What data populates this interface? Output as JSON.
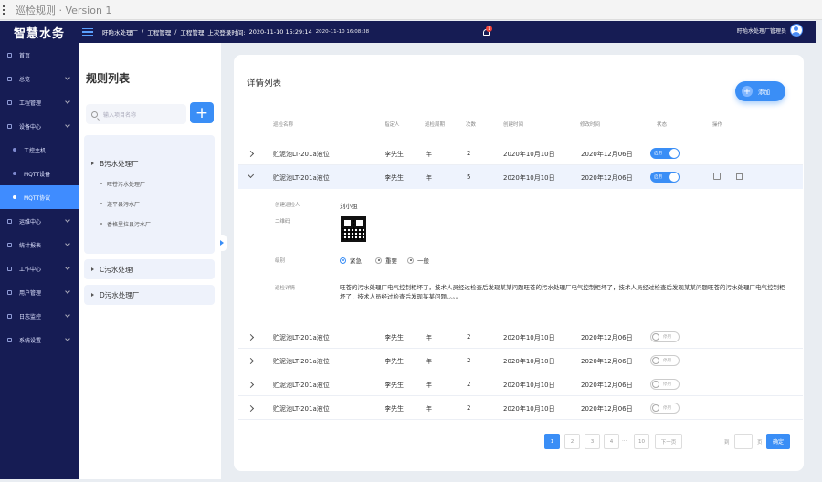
{
  "window": {
    "title": "巡检规则 · Version 1"
  },
  "topbar": {
    "brand": "智慧水务",
    "breadcrumb": [
      "盱眙水处理厂",
      "工程管理",
      "工程管理"
    ],
    "last_login_label": "上次登录时间:",
    "last_login_time": "2020-11-10 15:29:14",
    "current_time": "2020-11-10 16:08:38",
    "notification_count": "1",
    "user_name": "盱眙水处理厂管理员"
  },
  "sidebar": {
    "items": [
      {
        "label": "首页"
      },
      {
        "label": "总览"
      },
      {
        "label": "工程管理"
      },
      {
        "label": "设备中心"
      },
      {
        "label": "工控主机"
      },
      {
        "label": "MQTT设备"
      },
      {
        "label": "MQTT协议"
      },
      {
        "label": "运维中心"
      },
      {
        "label": "统计报表"
      },
      {
        "label": "工作中心"
      },
      {
        "label": "用户管理"
      },
      {
        "label": "日志监控"
      },
      {
        "label": "系统设置"
      }
    ]
  },
  "rules": {
    "title": "规则列表",
    "search_placeholder": "输入项目名称",
    "add_symbol": "+",
    "groups": [
      {
        "name": "B污水处理厂",
        "children": [
          "旺苍污水处理厂",
          "遂平县污水厂",
          "香格里拉县污水厂"
        ]
      },
      {
        "name": "C污水处理厂"
      },
      {
        "name": "D污水处理厂"
      }
    ]
  },
  "details": {
    "title": "详情列表",
    "add_label": "添加",
    "add_symbol": "+",
    "columns": [
      "巡检名称",
      "指定人",
      "巡检周期",
      "次数",
      "创建时间",
      "修改时间",
      "状态",
      "操作"
    ],
    "rows": [
      {
        "name": "贮泥池LT-201a液位",
        "person": "李先生",
        "period": "年",
        "count": "2",
        "created": "2020年10月10日",
        "modified": "2020年12月06日",
        "status": "启用"
      },
      {
        "name": "贮泥池LT-201a液位",
        "person": "李先生",
        "period": "年",
        "count": "5",
        "created": "2020年10月10日",
        "modified": "2020年12月06日",
        "status": "启用"
      },
      {
        "name": "贮泥池LT-201a液位",
        "person": "李先生",
        "period": "年",
        "count": "2",
        "created": "2020年10月10日",
        "modified": "2020年12月06日",
        "status": "停用"
      },
      {
        "name": "贮泥池LT-201a液位",
        "person": "李先生",
        "period": "年",
        "count": "2",
        "created": "2020年10月10日",
        "modified": "2020年12月06日",
        "status": "停用"
      },
      {
        "name": "贮泥池LT-201a液位",
        "person": "李先生",
        "period": "年",
        "count": "2",
        "created": "2020年10月10日",
        "modified": "2020年12月06日",
        "status": "停用"
      },
      {
        "name": "贮泥池LT-201a液位",
        "person": "李先生",
        "period": "年",
        "count": "2",
        "created": "2020年10月10日",
        "modified": "2020年12月06日",
        "status": "停用"
      }
    ],
    "expanded": {
      "creator_label": "创建巡检人",
      "creator": "刘小姐",
      "qrcode_label": "二维码",
      "level_label": "级别",
      "levels": [
        "紧急",
        "重要",
        "一般"
      ],
      "detail_label": "巡检详情",
      "detail_text": "旺苍的污水处理厂电气控制柜坏了，技术人员经过检查后发现某某问题旺苍的污水处理厂电气控制柜坏了，技术人员经过检查后发现某某问题旺苍的污水处理厂电气控制柜坏了，技术人员经过检查后发现某某问题。。。。"
    },
    "pagination": {
      "pages": [
        "1",
        "2",
        "3",
        "4",
        "...",
        "10"
      ],
      "next_label": "下一页",
      "goto_prefix": "到",
      "goto_suffix": "页",
      "confirm_label": "确定"
    }
  }
}
